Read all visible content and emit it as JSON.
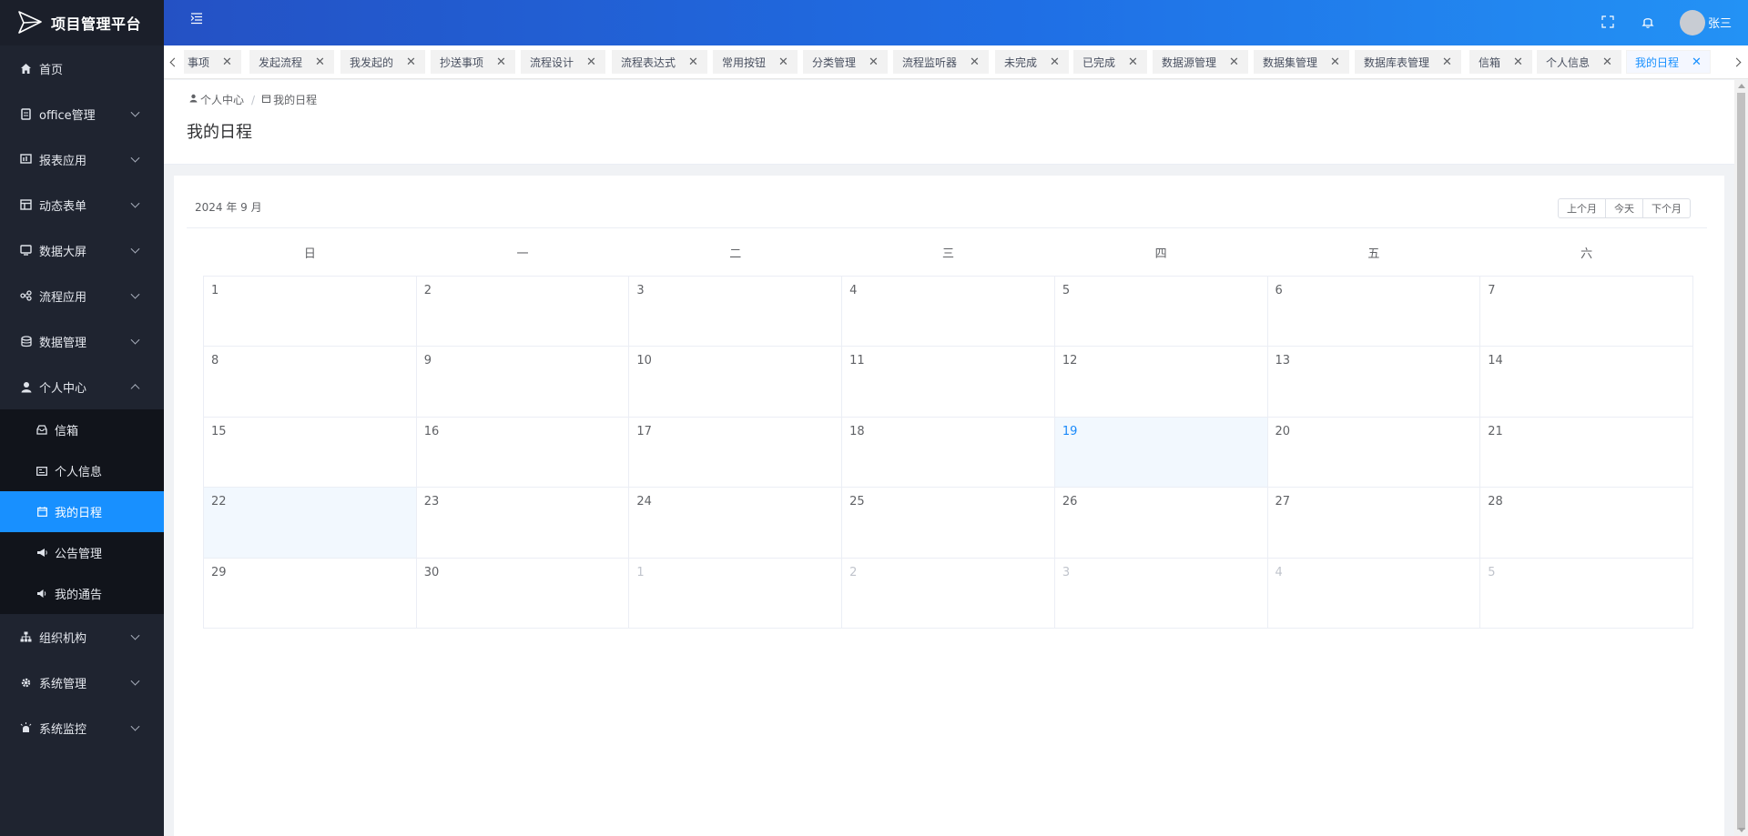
{
  "app": {
    "title": "项目管理平台"
  },
  "sidebar": {
    "items": [
      {
        "label": "首页",
        "icon": "home-icon"
      },
      {
        "label": "office管理",
        "icon": "document-icon"
      },
      {
        "label": "报表应用",
        "icon": "report-icon"
      },
      {
        "label": "动态表单",
        "icon": "table-icon"
      },
      {
        "label": "数据大屏",
        "icon": "monitor-icon"
      },
      {
        "label": "流程应用",
        "icon": "flow-icon"
      },
      {
        "label": "数据管理",
        "icon": "database-icon"
      },
      {
        "label": "个人中心",
        "icon": "user-icon",
        "expanded": true
      },
      {
        "label": "组织机构",
        "icon": "org-tree-icon"
      },
      {
        "label": "系统管理",
        "icon": "gear-icon"
      },
      {
        "label": "系统监控",
        "icon": "monitor-alert-icon"
      }
    ],
    "sub_items": [
      {
        "label": "信箱",
        "icon": "mailbox-icon"
      },
      {
        "label": "个人信息",
        "icon": "id-card-icon"
      },
      {
        "label": "我的日程",
        "icon": "calendar-icon",
        "active": true
      },
      {
        "label": "公告管理",
        "icon": "megaphone-icon"
      },
      {
        "label": "我的通告",
        "icon": "speaker-icon"
      }
    ]
  },
  "header": {
    "username": "张三",
    "accent": "#1890ff"
  },
  "tags": [
    {
      "label": "事项"
    },
    {
      "label": "发起流程"
    },
    {
      "label": "我发起的"
    },
    {
      "label": "抄送事项"
    },
    {
      "label": "流程设计"
    },
    {
      "label": "流程表达式"
    },
    {
      "label": "常用按钮"
    },
    {
      "label": "分类管理"
    },
    {
      "label": "流程监听器"
    },
    {
      "label": "未完成"
    },
    {
      "label": "已完成"
    },
    {
      "label": "数据源管理"
    },
    {
      "label": "数据集管理"
    },
    {
      "label": "数据库表管理"
    },
    {
      "label": "信箱"
    },
    {
      "label": "个人信息"
    },
    {
      "label": "我的日程",
      "active": true
    }
  ],
  "breadcrumb": {
    "parent": "个人中心",
    "current": "我的日程"
  },
  "page": {
    "title": "我的日程"
  },
  "calendar": {
    "title": "2024 年 9 月",
    "buttons": {
      "prev": "上个月",
      "today": "今天",
      "next": "下个月"
    },
    "weekdays": [
      "日",
      "一",
      "二",
      "三",
      "四",
      "五",
      "六"
    ],
    "weeks": [
      [
        "1",
        "2",
        "3",
        "4",
        "5",
        "6",
        "7"
      ],
      [
        "8",
        "9",
        "10",
        "11",
        "12",
        "13",
        "14"
      ],
      [
        "15",
        "16",
        "17",
        "18",
        "19",
        "20",
        "21"
      ],
      [
        "22",
        "23",
        "24",
        "25",
        "26",
        "27",
        "28"
      ],
      [
        "29",
        "30",
        "1",
        "2",
        "3",
        "4",
        "5"
      ]
    ],
    "today": "19",
    "selected": "22"
  }
}
